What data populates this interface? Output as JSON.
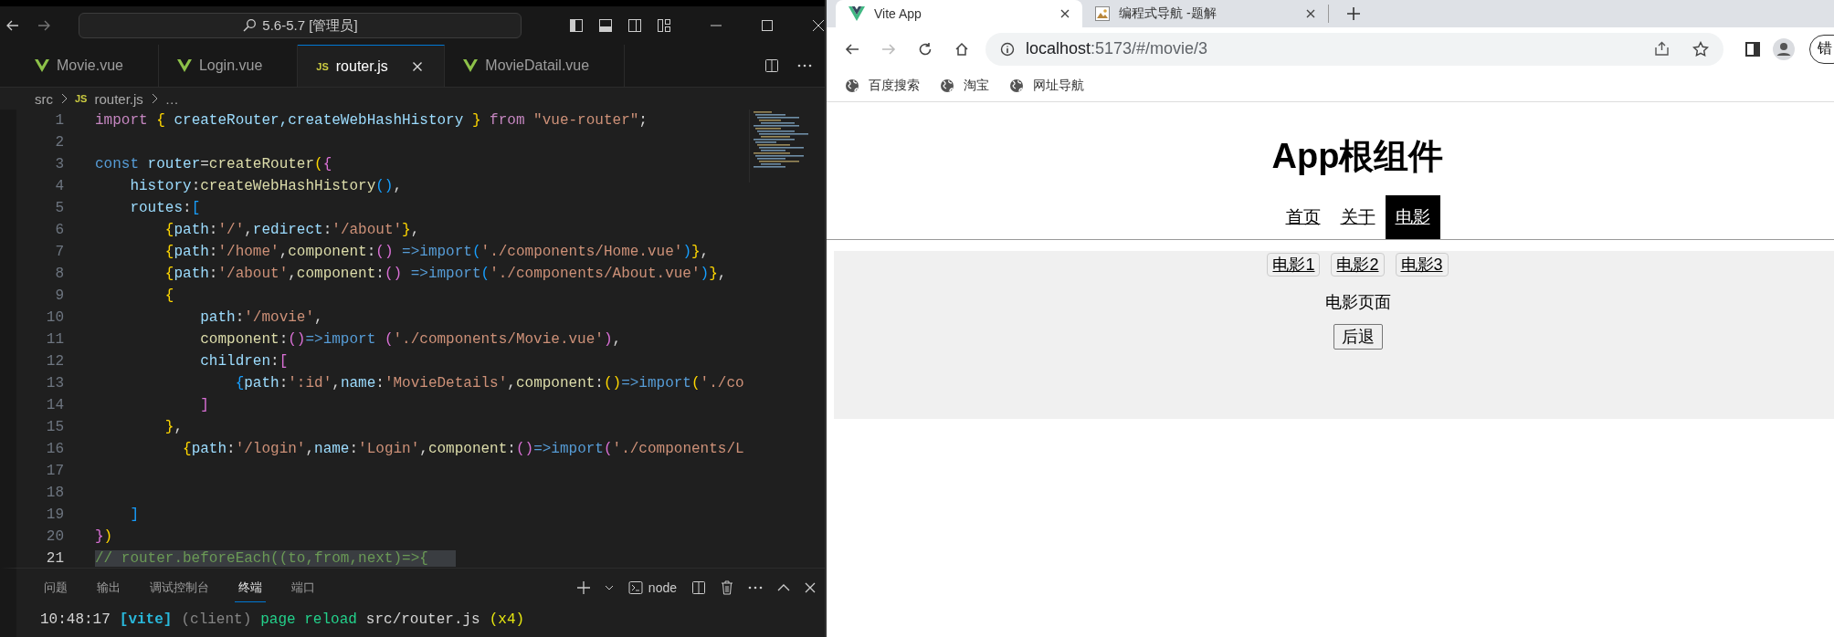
{
  "editor": {
    "command_center": "5.6-5.7 [管理员]",
    "tabs": [
      {
        "label": "Movie.vue",
        "kind": "vue",
        "selected": false
      },
      {
        "label": "Login.vue",
        "kind": "vue",
        "selected": false
      },
      {
        "label": "router.js",
        "kind": "js",
        "badge": "JS",
        "selected": true
      },
      {
        "label": "MovieDatail.vue",
        "kind": "vue",
        "selected": false
      }
    ],
    "breadcrumb": {
      "folder": "src",
      "file_badge": "JS",
      "file": "router.js",
      "more": "…"
    },
    "code_lines": [
      {
        "number": "1",
        "selected": false,
        "tokens": [
          {
            "kind": "kw",
            "text": "import "
          },
          {
            "kind": "b1",
            "text": "{"
          },
          {
            "kind": "var",
            "text": " createRouter,createWebHashHistory "
          },
          {
            "kind": "b1",
            "text": "} "
          },
          {
            "kind": "kw",
            "text": "from "
          },
          {
            "kind": "str",
            "text": "\"vue-router\""
          },
          {
            "kind": "plain",
            "text": ";"
          }
        ]
      },
      {
        "number": "2",
        "selected": false
      },
      {
        "number": "3",
        "selected": false,
        "tokens": [
          {
            "kind": "kw2",
            "text": "const"
          },
          {
            "kind": "var",
            "text": " router"
          },
          {
            "kind": "plain",
            "text": "="
          },
          {
            "kind": "fn",
            "text": "createRouter"
          },
          {
            "kind": "b1",
            "text": "("
          },
          {
            "kind": "b2",
            "text": "{"
          }
        ]
      },
      {
        "number": "4",
        "selected": false,
        "tokens": [
          {
            "kind": "var",
            "text": "    history"
          },
          {
            "kind": "plain",
            "text": ":"
          },
          {
            "kind": "fn",
            "text": "createWebHashHistory"
          },
          {
            "kind": "b3",
            "text": "()"
          },
          {
            "kind": "plain",
            "text": ","
          }
        ]
      },
      {
        "number": "5",
        "selected": false,
        "tokens": [
          {
            "kind": "var",
            "text": "    routes"
          },
          {
            "kind": "plain",
            "text": ":"
          },
          {
            "kind": "b3",
            "text": "["
          }
        ]
      },
      {
        "number": "6",
        "selected": false,
        "tokens": [
          {
            "kind": "b1",
            "text": "        {"
          },
          {
            "kind": "var",
            "text": "path"
          },
          {
            "kind": "plain",
            "text": ":"
          },
          {
            "kind": "str",
            "text": "'/'"
          },
          {
            "kind": "plain",
            "text": ","
          },
          {
            "kind": "var",
            "text": "redirect"
          },
          {
            "kind": "plain",
            "text": ":"
          },
          {
            "kind": "str",
            "text": "'/about'"
          },
          {
            "kind": "b1",
            "text": "}"
          },
          {
            "kind": "plain",
            "text": ","
          }
        ]
      },
      {
        "number": "7",
        "selected": false,
        "tokens": [
          {
            "kind": "b1",
            "text": "        {"
          },
          {
            "kind": "var",
            "text": "path"
          },
          {
            "kind": "plain",
            "text": ":"
          },
          {
            "kind": "str",
            "text": "'/home'"
          },
          {
            "kind": "plain",
            "text": ","
          },
          {
            "kind": "fn",
            "text": "component"
          },
          {
            "kind": "plain",
            "text": ":"
          },
          {
            "kind": "b2",
            "text": "()"
          },
          {
            "kind": "kw2",
            "text": " =>import"
          },
          {
            "kind": "b3",
            "text": "("
          },
          {
            "kind": "str",
            "text": "'./components/Home.vue'"
          },
          {
            "kind": "b3",
            "text": ")"
          },
          {
            "kind": "b1",
            "text": "}"
          },
          {
            "kind": "plain",
            "text": ","
          }
        ]
      },
      {
        "number": "8",
        "selected": false,
        "tokens": [
          {
            "kind": "b1",
            "text": "        {"
          },
          {
            "kind": "var",
            "text": "path"
          },
          {
            "kind": "plain",
            "text": ":"
          },
          {
            "kind": "str",
            "text": "'/about'"
          },
          {
            "kind": "plain",
            "text": ","
          },
          {
            "kind": "fn",
            "text": "component"
          },
          {
            "kind": "plain",
            "text": ":"
          },
          {
            "kind": "b2",
            "text": "()"
          },
          {
            "kind": "kw2",
            "text": " =>import"
          },
          {
            "kind": "b3",
            "text": "("
          },
          {
            "kind": "str",
            "text": "'./components/About.vue'"
          },
          {
            "kind": "b3",
            "text": ")"
          },
          {
            "kind": "b1",
            "text": "}"
          },
          {
            "kind": "plain",
            "text": ","
          }
        ]
      },
      {
        "number": "9",
        "selected": false,
        "tokens": [
          {
            "kind": "b1",
            "text": "        {"
          }
        ]
      },
      {
        "number": "10",
        "selected": false,
        "tokens": [
          {
            "kind": "var",
            "text": "            path"
          },
          {
            "kind": "plain",
            "text": ":"
          },
          {
            "kind": "str",
            "text": "'/movie'"
          },
          {
            "kind": "plain",
            "text": ","
          }
        ]
      },
      {
        "number": "11",
        "selected": false,
        "tokens": [
          {
            "kind": "fn",
            "text": "            component"
          },
          {
            "kind": "plain",
            "text": ":"
          },
          {
            "kind": "b2",
            "text": "()"
          },
          {
            "kind": "kw2",
            "text": "=>import "
          },
          {
            "kind": "b2",
            "text": "("
          },
          {
            "kind": "str",
            "text": "'./components/Movie.vue'"
          },
          {
            "kind": "b2",
            "text": ")"
          },
          {
            "kind": "plain",
            "text": ","
          }
        ]
      },
      {
        "number": "12",
        "selected": false,
        "tokens": [
          {
            "kind": "var",
            "text": "            children"
          },
          {
            "kind": "plain",
            "text": ":"
          },
          {
            "kind": "b2",
            "text": "["
          }
        ]
      },
      {
        "number": "13",
        "selected": false,
        "tokens": [
          {
            "kind": "b3",
            "text": "                {"
          },
          {
            "kind": "var",
            "text": "path"
          },
          {
            "kind": "plain",
            "text": ":"
          },
          {
            "kind": "str",
            "text": "':id'"
          },
          {
            "kind": "plain",
            "text": ","
          },
          {
            "kind": "var",
            "text": "name"
          },
          {
            "kind": "plain",
            "text": ":"
          },
          {
            "kind": "str",
            "text": "'MovieDetails'"
          },
          {
            "kind": "plain",
            "text": ","
          },
          {
            "kind": "fn",
            "text": "component"
          },
          {
            "kind": "plain",
            "text": ":"
          },
          {
            "kind": "b1",
            "text": "()"
          },
          {
            "kind": "kw2",
            "text": "=>import"
          },
          {
            "kind": "b1",
            "text": "("
          },
          {
            "kind": "str",
            "text": "'./co"
          }
        ]
      },
      {
        "number": "14",
        "selected": false,
        "tokens": [
          {
            "kind": "b2",
            "text": "            ]"
          }
        ]
      },
      {
        "number": "15",
        "selected": false,
        "tokens": [
          {
            "kind": "b1",
            "text": "        }"
          },
          {
            "kind": "plain",
            "text": ","
          }
        ]
      },
      {
        "number": "16",
        "selected": false,
        "tokens": [
          {
            "kind": "b1",
            "text": "          {"
          },
          {
            "kind": "var",
            "text": "path"
          },
          {
            "kind": "plain",
            "text": ":"
          },
          {
            "kind": "str",
            "text": "'/login'"
          },
          {
            "kind": "plain",
            "text": ","
          },
          {
            "kind": "var",
            "text": "name"
          },
          {
            "kind": "plain",
            "text": ":"
          },
          {
            "kind": "str",
            "text": "'Login'"
          },
          {
            "kind": "plain",
            "text": ","
          },
          {
            "kind": "fn",
            "text": "component"
          },
          {
            "kind": "plain",
            "text": ":"
          },
          {
            "kind": "b2",
            "text": "()"
          },
          {
            "kind": "kw2",
            "text": "=>import"
          },
          {
            "kind": "b2",
            "text": "("
          },
          {
            "kind": "str",
            "text": "'./components/L"
          }
        ]
      },
      {
        "number": "17",
        "selected": false
      },
      {
        "number": "18",
        "selected": false
      },
      {
        "number": "19",
        "selected": false,
        "tokens": [
          {
            "kind": "b3",
            "text": "    ]"
          }
        ]
      },
      {
        "number": "20",
        "selected": false,
        "tokens": [
          {
            "kind": "b2",
            "text": "}"
          },
          {
            "kind": "b1",
            "text": ")"
          }
        ]
      },
      {
        "number": "21",
        "selected": true,
        "tokens": [
          {
            "kind": "cm",
            "text": "// router.beforeEach((to,from,next)=>{"
          }
        ]
      }
    ],
    "panel": {
      "tabs": [
        {
          "label": "问题",
          "selected": false
        },
        {
          "label": "输出",
          "selected": false
        },
        {
          "label": "调试控制台",
          "selected": false
        },
        {
          "label": "终端",
          "selected": true
        },
        {
          "label": "端口",
          "selected": false
        }
      ],
      "shell": "node",
      "terminal_line": [
        {
          "kind": "plain",
          "text": "10:48:17"
        },
        {
          "kind": "tag",
          "text": "[vite]"
        },
        {
          "kind": "dim",
          "text": "(client)"
        },
        {
          "kind": "ok",
          "text": "page reload"
        },
        {
          "kind": "plain",
          "text": "src/router.js"
        },
        {
          "kind": "count",
          "text": "(x4)"
        }
      ]
    }
  },
  "browser": {
    "tabs": [
      {
        "title": "Vite App",
        "kind": "vue",
        "selected": true
      },
      {
        "title": "编程式导航 -题解",
        "kind": "image",
        "selected": false
      }
    ],
    "address": {
      "host": "localhost",
      "path": ":5173/#/movie/3"
    },
    "profile_button": "错",
    "bookmarks": [
      "百度搜索",
      "淘宝",
      "网址导航"
    ],
    "page": {
      "heading": "App根组件",
      "nav": [
        {
          "label": "首页",
          "selected": false
        },
        {
          "label": "关于",
          "selected": false
        },
        {
          "label": "电影",
          "selected": true
        }
      ],
      "movie_links": [
        "电影1",
        "电影2",
        "电影3"
      ],
      "content": "电影页面",
      "back_button": "后退"
    }
  }
}
